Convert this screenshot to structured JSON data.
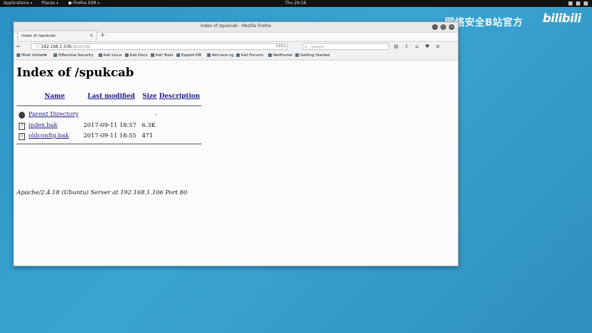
{
  "panel": {
    "applications": "Applications",
    "places": "Places",
    "app": "Firefox ESR",
    "clock": "Thu 29:18"
  },
  "watermark": {
    "text": "网络安全B站官方",
    "logo": "bilibili"
  },
  "window": {
    "title": "Index of /spukcab - Mozilla Firefox"
  },
  "tab": {
    "label": "Index of /spukcab"
  },
  "nav": {
    "url_host": "192.168.1.106",
    "url_rest": "/spukcab",
    "zoom": "133%",
    "search_placeholder": "Search"
  },
  "bookmarks": [
    {
      "label": "Most Visited"
    },
    {
      "label": "Offensive Security"
    },
    {
      "label": "Kali Linux"
    },
    {
      "label": "Kali Docs"
    },
    {
      "label": "Kali Tools"
    },
    {
      "label": "Exploit-DB"
    },
    {
      "label": "Aircrack-ng"
    },
    {
      "label": "Kali Forums"
    },
    {
      "label": "NetHunter"
    },
    {
      "label": "Getting Started"
    }
  ],
  "page": {
    "title": "Index of /spukcab",
    "headers": {
      "name": "Name",
      "modified": "Last modified",
      "size": "Size",
      "description": "Description"
    },
    "parent": {
      "name": "Parent Directory",
      "size": "-"
    },
    "files": [
      {
        "name": "index.bak",
        "modified": "2017-09-11 18:57",
        "size": "6.3K"
      },
      {
        "name": "oldconfig.bak",
        "modified": "2017-09-11 18:55",
        "size": "471"
      }
    ],
    "address": "Apache/2.4.18 (Ubuntu) Server at 192.168.1.106 Port 80"
  }
}
